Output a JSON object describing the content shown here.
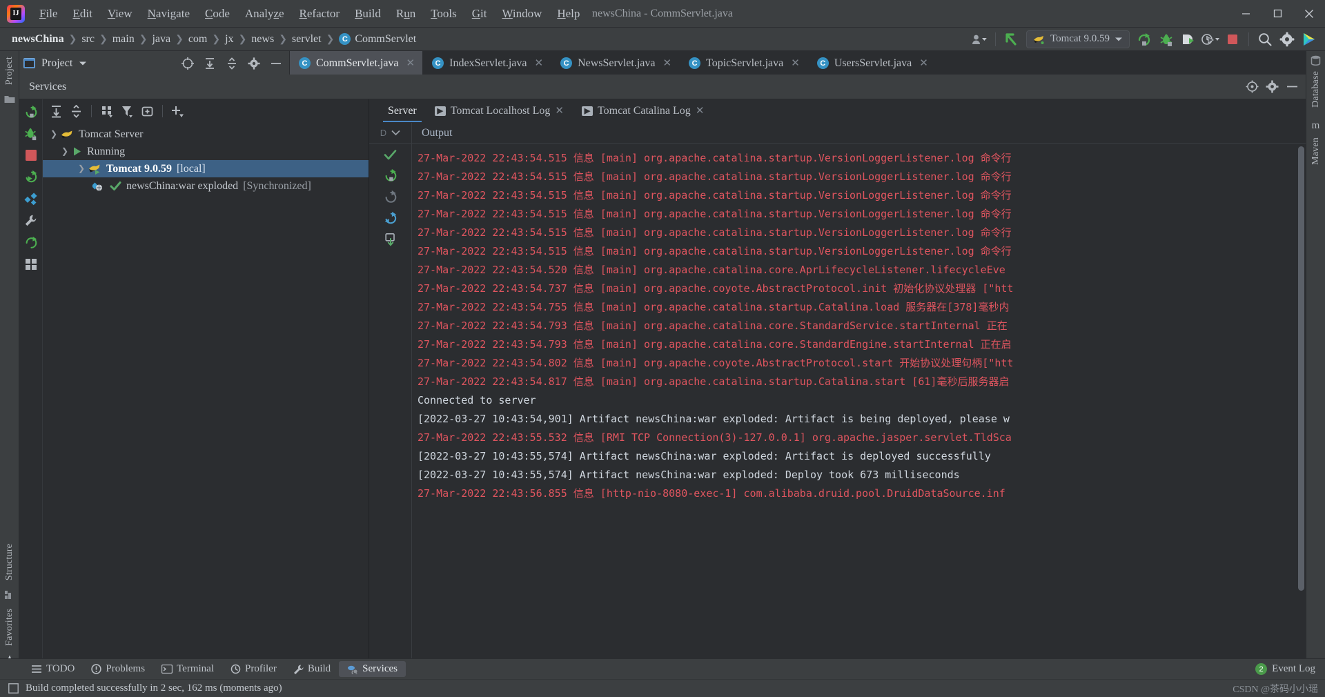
{
  "window": {
    "title": "newsChina - CommServlet.java",
    "controls": [
      "minimize",
      "maximize",
      "close"
    ]
  },
  "menu": [
    {
      "label": "File",
      "mnemonic": "F"
    },
    {
      "label": "Edit",
      "mnemonic": "E"
    },
    {
      "label": "View",
      "mnemonic": "V"
    },
    {
      "label": "Navigate",
      "mnemonic": "N"
    },
    {
      "label": "Code",
      "mnemonic": "C"
    },
    {
      "label": "Analyze",
      "mnemonic": "z"
    },
    {
      "label": "Refactor",
      "mnemonic": "R"
    },
    {
      "label": "Build",
      "mnemonic": "B"
    },
    {
      "label": "Run",
      "mnemonic": "u"
    },
    {
      "label": "Tools",
      "mnemonic": "T"
    },
    {
      "label": "Git",
      "mnemonic": "G"
    },
    {
      "label": "Window",
      "mnemonic": "W"
    },
    {
      "label": "Help",
      "mnemonic": "H"
    }
  ],
  "breadcrumbs": [
    "newsChina",
    "src",
    "main",
    "java",
    "com",
    "jx",
    "news",
    "servlet",
    "CommServlet"
  ],
  "breadcrumb_class_badge": "C",
  "toolbar": {
    "run_config": "Tomcat 9.0.59",
    "run_config_icon": "tomcat-cat-icon",
    "buttons": [
      "profile-user-icon",
      "back-arrow-icon",
      "rerun-icon",
      "debug-icon",
      "run-coverage-icon",
      "profiler-dropdown-icon",
      "stop-icon",
      "search-everywhere-icon",
      "settings-gear-icon",
      "updates-icon"
    ]
  },
  "project_tool": {
    "label": "Project",
    "icons": [
      "locate-icon",
      "collapse-all-icon",
      "expand-all-icon",
      "gear-icon",
      "hide-icon"
    ]
  },
  "editor_tabs": [
    {
      "label": "CommServlet.java",
      "active": true
    },
    {
      "label": "IndexServlet.java",
      "active": false
    },
    {
      "label": "NewsServlet.java",
      "active": false
    },
    {
      "label": "TopicServlet.java",
      "active": false
    },
    {
      "label": "UsersServlet.java",
      "active": false
    }
  ],
  "left_strips": {
    "top": "Project",
    "bottom1": "Structure",
    "bottom2": "Favorites"
  },
  "right_strips": {
    "top": "Database",
    "second": "Maven"
  },
  "services": {
    "title": "Services",
    "header_icons": [
      "target-icon",
      "settings-gear-icon",
      "minimize-icon"
    ],
    "toolbar_icons": [
      "rerun-icon",
      "debug-icon",
      "stop-icon",
      "restart-icon",
      "deploy-icon",
      "tools-icon",
      "refresh-icon",
      "dashboard-icon"
    ],
    "tree_toolbar_icons": [
      "expand-all-icon",
      "collapse-all-icon",
      "group-by-icon",
      "filter-icon",
      "add-frame-icon",
      "add-icon"
    ],
    "tree": [
      {
        "label": "Tomcat Server",
        "icon": "tomcat-cat-icon",
        "indent": 0,
        "arrow": "expanded",
        "selected": false,
        "suffix": ""
      },
      {
        "label": "Running",
        "icon": "run-green-icon",
        "indent": 1,
        "arrow": "expanded",
        "selected": false,
        "suffix": ""
      },
      {
        "label": "Tomcat 9.0.59",
        "icon": "tomcat-run-icon",
        "indent": 2,
        "arrow": "expanded",
        "selected": true,
        "suffix": "[local]"
      },
      {
        "label": "newsChina:war exploded",
        "icon": "artifact-check-icon",
        "indent": 3,
        "arrow": "none",
        "selected": false,
        "suffix": "[Synchronized]"
      }
    ]
  },
  "log_tabs": [
    {
      "label": "Server",
      "active": true,
      "icon": "none",
      "closable": false
    },
    {
      "label": "Tomcat Localhost Log",
      "active": false,
      "icon": "run-icon",
      "closable": true
    },
    {
      "label": "Tomcat Catalina Log",
      "active": false,
      "icon": "run-icon",
      "closable": true
    }
  ],
  "output": {
    "header": "Output",
    "gutter_icons": [
      "scroll-up-icon",
      "scroll-down-icon",
      "soft-wrap-icon",
      "scroll-end-icon",
      "print-icon",
      "trash-icon"
    ],
    "left_icons": [
      "check-green-icon",
      "rerun-icon",
      "rerun-dim-icon",
      "restart-icon",
      "deploy-icon"
    ],
    "lines": [
      {
        "text": "27-Mar-2022 22:43:54.515 信息 [main] org.apache.catalina.startup.VersionLoggerListener.log 命令行",
        "level": "error"
      },
      {
        "text": "27-Mar-2022 22:43:54.515 信息 [main] org.apache.catalina.startup.VersionLoggerListener.log 命令行",
        "level": "error"
      },
      {
        "text": "27-Mar-2022 22:43:54.515 信息 [main] org.apache.catalina.startup.VersionLoggerListener.log 命令行",
        "level": "error"
      },
      {
        "text": "27-Mar-2022 22:43:54.515 信息 [main] org.apache.catalina.startup.VersionLoggerListener.log 命令行",
        "level": "error"
      },
      {
        "text": "27-Mar-2022 22:43:54.515 信息 [main] org.apache.catalina.startup.VersionLoggerListener.log 命令行",
        "level": "error"
      },
      {
        "text": "27-Mar-2022 22:43:54.515 信息 [main] org.apache.catalina.startup.VersionLoggerListener.log 命令行",
        "level": "error"
      },
      {
        "text": "27-Mar-2022 22:43:54.520 信息 [main] org.apache.catalina.core.AprLifecycleListener.lifecycleEve",
        "level": "error"
      },
      {
        "text": "27-Mar-2022 22:43:54.737 信息 [main] org.apache.coyote.AbstractProtocol.init 初始化协议处理器 [\"htt",
        "level": "error"
      },
      {
        "text": "27-Mar-2022 22:43:54.755 信息 [main] org.apache.catalina.startup.Catalina.load 服务器在[378]毫秒内",
        "level": "error"
      },
      {
        "text": "27-Mar-2022 22:43:54.793 信息 [main] org.apache.catalina.core.StandardService.startInternal 正在",
        "level": "error"
      },
      {
        "text": "27-Mar-2022 22:43:54.793 信息 [main] org.apache.catalina.core.StandardEngine.startInternal 正在启",
        "level": "error"
      },
      {
        "text": "27-Mar-2022 22:43:54.802 信息 [main] org.apache.coyote.AbstractProtocol.start 开始协议处理句柄[\"htt",
        "level": "error"
      },
      {
        "text": "27-Mar-2022 22:43:54.817 信息 [main] org.apache.catalina.startup.Catalina.start [61]毫秒后服务器启",
        "level": "error"
      },
      {
        "text": "Connected to server",
        "level": "info"
      },
      {
        "text": "[2022-03-27 10:43:54,901] Artifact newsChina:war exploded: Artifact is being deployed, please w",
        "level": "info"
      },
      {
        "text": "27-Mar-2022 22:43:55.532 信息 [RMI TCP Connection(3)-127.0.0.1] org.apache.jasper.servlet.TldSca",
        "level": "error"
      },
      {
        "text": "[2022-03-27 10:43:55,574] Artifact newsChina:war exploded: Artifact is deployed successfully",
        "level": "info"
      },
      {
        "text": "[2022-03-27 10:43:55,574] Artifact newsChina:war exploded: Deploy took 673 milliseconds",
        "level": "info"
      },
      {
        "text": "27-Mar-2022 22:43:56.855 信息 [http-nio-8080-exec-1] com.alibaba.druid.pool.DruidDataSource.inf",
        "level": "error"
      }
    ]
  },
  "bottom_bar": {
    "items": [
      {
        "label": "TODO",
        "icon": "todo-icon",
        "active": false
      },
      {
        "label": "Problems",
        "icon": "problems-icon",
        "active": false
      },
      {
        "label": "Terminal",
        "icon": "terminal-icon",
        "active": false
      },
      {
        "label": "Profiler",
        "icon": "profiler-icon",
        "active": false
      },
      {
        "label": "Build",
        "icon": "build-icon",
        "active": false
      },
      {
        "label": "Services",
        "icon": "services-icon",
        "active": true
      }
    ],
    "event_log": {
      "label": "Event Log",
      "count": "2"
    }
  },
  "status": {
    "text": "Build completed successfully in 2 sec, 162 ms (moments ago)",
    "icon": "build-status-icon",
    "watermark": "CSDN @茶码小小瑶"
  },
  "colors": {
    "accent_blue": "#3d6185",
    "error_red": "#e0555f",
    "info_gray": "#cfd6de",
    "green": "#5aa85a",
    "tab_active_bg": "#4e5157",
    "panel_bg": "#2b2d30",
    "chrome_bg": "#3c3f41"
  }
}
